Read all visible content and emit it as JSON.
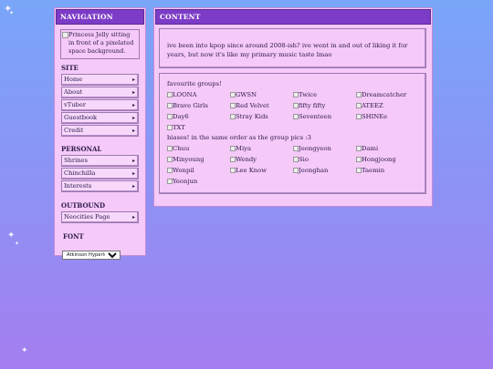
{
  "decor": {
    "sparkle_glyph": "✦"
  },
  "nav": {
    "header": "NAVIGATION",
    "portrait_alt": "Princess Jelly sitting in front of a pixelated space background.",
    "sections": [
      {
        "title": "SITE",
        "items": [
          "Home",
          "About",
          "vTuber",
          "Guestbook",
          "Credit"
        ]
      },
      {
        "title": "PERSONAL",
        "items": [
          "Shrines",
          "Chinchilla",
          "Interests"
        ]
      },
      {
        "title": "OUTBOUND",
        "items": [
          "Neocities Page"
        ]
      }
    ],
    "font": {
      "title": "FONT",
      "selected": "Atkinson Hyperlegible"
    }
  },
  "content": {
    "header": "CONTENT",
    "intro": "ive been into kpop since around 2008-ish? ive went in and out of liking it for years, but now it's like my primary music taste lmao",
    "groups_label": "favourite groups!",
    "groups": [
      "LOONA",
      "GWSN",
      "Twice",
      "Dreamcatcher",
      "Brave Girls",
      "Red Velvet",
      "fifty fifty",
      "ATEEZ",
      "Day6",
      "Stray Kids",
      "Seventeen",
      "SHINEe",
      "TXT"
    ],
    "biases_label": "biases! in the same order as the group pics :3",
    "biases": [
      "Chuu",
      "Miya",
      "Jeongyeon",
      "Dami",
      "Minyoung",
      "Wendy",
      "Sio",
      "Hongjoong",
      "Wonpil",
      "Lee Know",
      "Jeonghan",
      "Taemin",
      "Yeonjun"
    ]
  }
}
